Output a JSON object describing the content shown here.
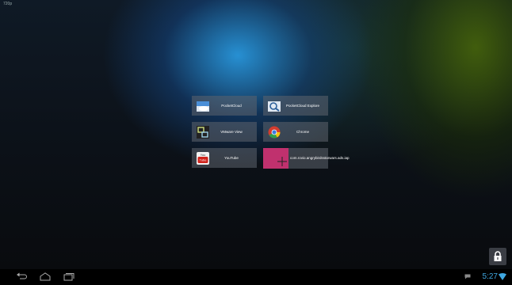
{
  "status": {
    "resolution": "720p"
  },
  "apps": [
    {
      "name": "PocketCloud",
      "icon": "pocketcloud-icon"
    },
    {
      "name": "PocketCloud Explore",
      "icon": "pocketcloud-explore-icon"
    },
    {
      "name": "VMware View",
      "icon": "vmware-view-icon"
    },
    {
      "name": "Chrome",
      "icon": "chrome-icon"
    },
    {
      "name": "YouTube",
      "icon": "youtube-icon"
    },
    {
      "name": "com.rovio.angrybirdsstarwars.ads.iap",
      "icon": "add-app-icon"
    }
  ],
  "navbar": {
    "time": "5:27"
  },
  "colors": {
    "accent": "#3fa7e0",
    "add_tile": "#c0316e"
  }
}
